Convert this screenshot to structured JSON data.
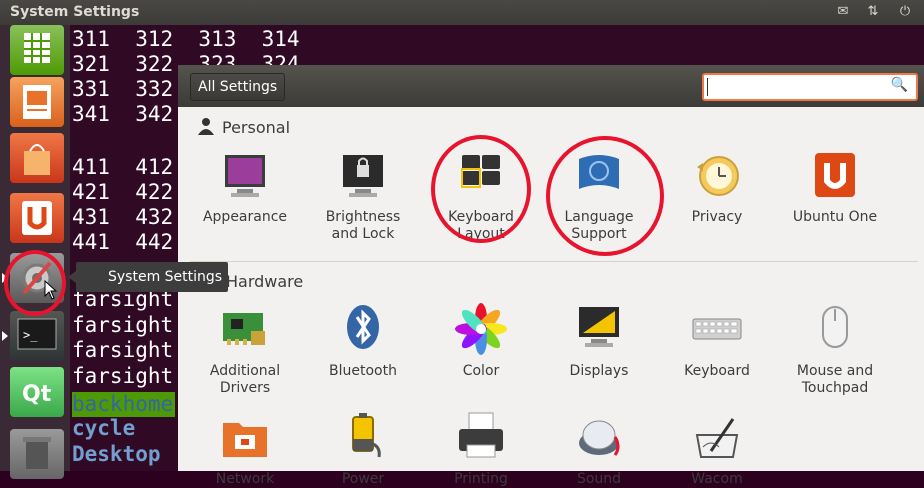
{
  "window": {
    "title": "System Settings"
  },
  "indicators": [
    {
      "name": "mail-icon"
    },
    {
      "name": "network-icon"
    },
    {
      "name": "power-icon"
    }
  ],
  "terminal": {
    "lines": [
      "311  312  313  314",
      "321  322  323  324",
      "331  332",
      "341  342",
      "",
      "411  412",
      "421  422",
      "431  432",
      "441  442",
      "",
      "farsight",
      "farsight",
      "farsight",
      "farsight",
      "backhome",
      "cycle",
      "Desktop"
    ]
  },
  "launcher": {
    "items": [
      {
        "name": "spreadsheet-icon",
        "color": "#4e9a06"
      },
      {
        "name": "presentation-icon",
        "color": "#e9722b"
      },
      {
        "name": "shopping-bag-icon",
        "color": "#dd4814"
      },
      {
        "name": "ubuntu-one-icon",
        "color": "#dd4814"
      },
      {
        "name": "system-settings-icon",
        "color": "#6b6b6b"
      },
      {
        "name": "terminal-icon",
        "color": "#2e3436"
      },
      {
        "name": "qt-creator-icon",
        "color": "#41cd52"
      },
      {
        "name": "trash-icon",
        "color": "#888a85"
      }
    ]
  },
  "tooltip": {
    "label": "System Settings"
  },
  "settings": {
    "all_settings_label": "All Settings",
    "search_placeholder": "",
    "personal": {
      "title": "Personal",
      "items": [
        {
          "line1": "Appearance",
          "line2": "",
          "icon": "appearance-icon"
        },
        {
          "line1": "Brightness",
          "line2": "and Lock",
          "icon": "brightness-lock-icon"
        },
        {
          "line1": "Keyboard",
          "line2": "Layout",
          "icon": "keyboard-layout-icon"
        },
        {
          "line1": "Language",
          "line2": "Support",
          "icon": "language-support-icon"
        },
        {
          "line1": "Privacy",
          "line2": "",
          "icon": "privacy-icon"
        },
        {
          "line1": "Ubuntu One",
          "line2": "",
          "icon": "ubuntu-one-icon"
        }
      ]
    },
    "hardware": {
      "title": "Hardware",
      "items": [
        {
          "line1": "Additional",
          "line2": "Drivers",
          "icon": "additional-drivers-icon"
        },
        {
          "line1": "Bluetooth",
          "line2": "",
          "icon": "bluetooth-icon"
        },
        {
          "line1": "Color",
          "line2": "",
          "icon": "color-icon"
        },
        {
          "line1": "Displays",
          "line2": "",
          "icon": "displays-icon"
        },
        {
          "line1": "Keyboard",
          "line2": "",
          "icon": "keyboard-icon"
        },
        {
          "line1": "Mouse and",
          "line2": "Touchpad",
          "icon": "mouse-touchpad-icon"
        }
      ]
    },
    "row3": {
      "items": [
        {
          "line1": "Network",
          "icon": "network-icon"
        },
        {
          "line1": "Power",
          "icon": "power-icon"
        },
        {
          "line1": "Printing",
          "icon": "printing-icon"
        },
        {
          "line1": "Sound",
          "icon": "sound-icon"
        },
        {
          "line1": "Wacom",
          "icon": "wacom-icon"
        }
      ]
    }
  },
  "colors": {
    "accent": "#dd4814",
    "highlight": "#e8142d",
    "terminal_bg": "#300a24",
    "terminal_highlight": "#4e9a06",
    "terminal_link": "#729fcf"
  }
}
